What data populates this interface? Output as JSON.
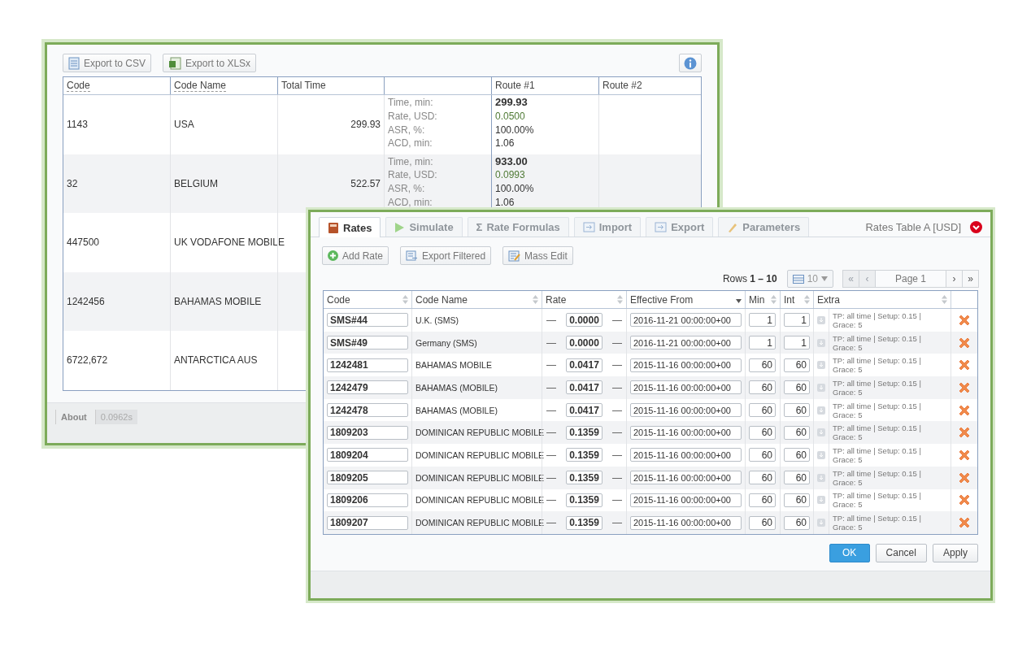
{
  "report_window": {
    "toolbar": [
      "Export to CSV",
      "Export to XLSx"
    ],
    "table": {
      "columns": [
        {
          "label": "Code",
          "underlined": true
        },
        {
          "label": "Code Name",
          "underlined": true
        },
        {
          "label": "Total Time",
          "underlined": false
        },
        {
          "label": "Route #1",
          "underlined": false
        },
        {
          "label": "Route #2",
          "underlined": false
        }
      ],
      "rows": [
        {
          "code": "1143",
          "code_name": "USA",
          "total_time": "299.93",
          "stats": [
            {
              "label": "Time, min:",
              "value": "299.93",
              "kind": "time"
            },
            {
              "label": "Rate, USD:",
              "value": "0.0500",
              "kind": "rate"
            },
            {
              "label": "ASR, %:",
              "value": "100.00%",
              "kind": "plain"
            },
            {
              "label": "ACD, min:",
              "value": "1.06",
              "kind": "plain"
            }
          ]
        },
        {
          "code": "32",
          "code_name": "BELGIUM",
          "total_time": "522.57",
          "stats": [
            {
              "label": "Time, min:",
              "value": "933.00",
              "kind": "time"
            },
            {
              "label": "Rate, USD:",
              "value": "0.0993",
              "kind": "rate"
            },
            {
              "label": "ASR, %:",
              "value": "100.00%",
              "kind": "plain"
            },
            {
              "label": "ACD, min:",
              "value": "1.06",
              "kind": "plain"
            }
          ]
        },
        {
          "code": "447500",
          "code_name": "UK VODAFONE MOBILE"
        },
        {
          "code": "1242456",
          "code_name": "BAHAMAS MOBILE"
        },
        {
          "code": "6722,672",
          "code_name": "ANTARCTICA AUS"
        }
      ]
    },
    "footer": {
      "about": "About",
      "timing": "0.0962s"
    }
  },
  "rates_window": {
    "tabs": [
      {
        "label": "Rates",
        "selected": true
      },
      {
        "label": "Simulate",
        "selected": false
      },
      {
        "label": "Rate Formulas",
        "glyph": "Σ",
        "selected": false
      },
      {
        "label": "Import",
        "selected": false
      },
      {
        "label": "Export",
        "selected": false
      },
      {
        "label": "Parameters",
        "selected": false
      }
    ],
    "title": "Rates Table A [USD]",
    "toolbar": [
      "Add Rate",
      "Export Filtered",
      "Mass Edit"
    ],
    "rows_info": {
      "label": "Rows",
      "range": "1 – 10"
    },
    "page_size": "10",
    "pagination": {
      "first": {
        "label": "«",
        "disabled": true
      },
      "prev": {
        "label": "‹",
        "disabled": true
      },
      "page": "Page 1",
      "next": {
        "label": "›",
        "disabled": false
      },
      "last": {
        "label": "»",
        "disabled": false
      }
    },
    "columns": [
      {
        "label": "Code",
        "sorted": false
      },
      {
        "label": "Code Name",
        "sorted": false
      },
      {
        "label": "Rate",
        "sorted": false
      },
      {
        "label": "Effective From",
        "sorted": true
      },
      {
        "label": "Min",
        "sorted": false
      },
      {
        "label": "Int",
        "sorted": false
      },
      {
        "label": "Extra",
        "sorted": false
      }
    ],
    "rows": [
      {
        "code": "SMS#44",
        "code_name": "U.K. (SMS)",
        "lower": "—",
        "rate": "0.0000",
        "upper": "—",
        "effective_from": "2016-11-21 00:00:00+00",
        "min": "1",
        "int": "1",
        "extra": "TP: all time | Setup: 0.15 | Grace: 5"
      },
      {
        "code": "SMS#49",
        "code_name": "Germany (SMS)",
        "lower": "—",
        "rate": "0.0000",
        "upper": "—",
        "effective_from": "2016-11-21 00:00:00+00",
        "min": "1",
        "int": "1",
        "extra": "TP: all time | Setup: 0.15 | Grace: 5"
      },
      {
        "code": "1242481",
        "code_name": "BAHAMAS MOBILE",
        "lower": "—",
        "rate": "0.0417",
        "upper": "—",
        "effective_from": "2015-11-16 00:00:00+00",
        "min": "60",
        "int": "60",
        "extra": "TP: all time | Setup: 0.15 | Grace: 5"
      },
      {
        "code": "1242479",
        "code_name": "BAHAMAS (MOBILE)",
        "lower": "—",
        "rate": "0.0417",
        "upper": "—",
        "effective_from": "2015-11-16 00:00:00+00",
        "min": "60",
        "int": "60",
        "extra": "TP: all time | Setup: 0.15 | Grace: 5"
      },
      {
        "code": "1242478",
        "code_name": "BAHAMAS (MOBILE)",
        "lower": "—",
        "rate": "0.0417",
        "upper": "—",
        "effective_from": "2015-11-16 00:00:00+00",
        "min": "60",
        "int": "60",
        "extra": "TP: all time | Setup: 0.15 | Grace: 5"
      },
      {
        "code": "1809203",
        "code_name": "DOMINICAN REPUBLIC MOBILE",
        "lower": "—",
        "rate": "0.1359",
        "upper": "—",
        "effective_from": "2015-11-16 00:00:00+00",
        "min": "60",
        "int": "60",
        "extra": "TP: all time | Setup: 0.15 | Grace: 5"
      },
      {
        "code": "1809204",
        "code_name": "DOMINICAN REPUBLIC MOBILE",
        "lower": "—",
        "rate": "0.1359",
        "upper": "—",
        "effective_from": "2015-11-16 00:00:00+00",
        "min": "60",
        "int": "60",
        "extra": "TP: all time | Setup: 0.15 | Grace: 5"
      },
      {
        "code": "1809205",
        "code_name": "DOMINICAN REPUBLIC MOBILE",
        "lower": "—",
        "rate": "0.1359",
        "upper": "—",
        "effective_from": "2015-11-16 00:00:00+00",
        "min": "60",
        "int": "60",
        "extra": "TP: all time | Setup: 0.15 | Grace: 5"
      },
      {
        "code": "1809206",
        "code_name": "DOMINICAN REPUBLIC MOBILE",
        "lower": "—",
        "rate": "0.1359",
        "upper": "—",
        "effective_from": "2015-11-16 00:00:00+00",
        "min": "60",
        "int": "60",
        "extra": "TP: all time | Setup: 0.15 | Grace: 5"
      },
      {
        "code": "1809207",
        "code_name": "DOMINICAN REPUBLIC MOBILE",
        "lower": "—",
        "rate": "0.1359",
        "upper": "—",
        "effective_from": "2015-11-16 00:00:00+00",
        "min": "60",
        "int": "60",
        "extra": "TP: all time | Setup: 0.15 | Grace: 5"
      }
    ],
    "buttons": [
      {
        "label": "OK",
        "primary": true
      },
      {
        "label": "Cancel",
        "primary": false
      },
      {
        "label": "Apply",
        "primary": false
      }
    ]
  }
}
